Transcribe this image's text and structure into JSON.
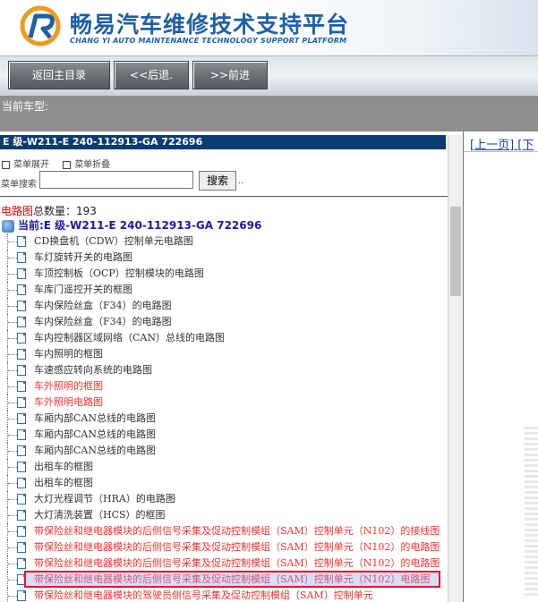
{
  "header": {
    "title": "畅易汽车维修技术支持平台",
    "subtitle": "CHANG YI AUTO MAINTENANCE TECHNOLOGY SUPPORT PLATFORM"
  },
  "nav": {
    "back_main": "返回主目录",
    "back": "<<后退.",
    "forward": ">>前进"
  },
  "current_model_label": "当前车型:",
  "vehicle": "E 级-W211-E 240-112913-GA 722696",
  "menu": {
    "expand": "菜单展开",
    "collapse": "菜单折叠",
    "search_label": "菜单搜索",
    "search_value": "",
    "search_button": "搜索",
    "dots": ".."
  },
  "count": {
    "prefix": "电路图",
    "label": "总数量：",
    "value": "193"
  },
  "root_label": "当前:E 级-W211-E 240-112913-GA 722696",
  "items": [
    {
      "label": "CD换盘机（CDW）控制单元电路图",
      "red": false
    },
    {
      "label": "车灯旋转开关的电路图",
      "red": false
    },
    {
      "label": "车顶控制板（OCP）控制模块的电路图",
      "red": false
    },
    {
      "label": "车库门遥控开关的框图",
      "red": false
    },
    {
      "label": "车内保险丝盒（F34）的电路图",
      "red": false
    },
    {
      "label": "车内保险丝盒（F34）的电路图",
      "red": false
    },
    {
      "label": "车内控制器区域网络（CAN）总线的电路图",
      "red": false
    },
    {
      "label": "车内照明的框图",
      "red": false
    },
    {
      "label": "车速感应转向系统的电路图",
      "red": false
    },
    {
      "label": "车外照明的框图",
      "red": true
    },
    {
      "label": "车外照明电路图",
      "red": true
    },
    {
      "label": "车厢内部CAN总线的电路图",
      "red": false
    },
    {
      "label": "车厢内部CAN总线的电路图",
      "red": false
    },
    {
      "label": "车厢内部CAN总线的电路图",
      "red": false
    },
    {
      "label": "出租车的框图",
      "red": false
    },
    {
      "label": "出租车的框图",
      "red": false
    },
    {
      "label": "大灯光程调节（HRA）的电路图",
      "red": false
    },
    {
      "label": "大灯清洗装置（HCS）的框图",
      "red": false
    },
    {
      "label": "带保险丝和继电器模块的后侧信号采集及促动控制模组（SAM）控制单元（N102）的接线图",
      "red": true
    },
    {
      "label": "带保险丝和继电器模块的后侧信号采集及促动控制模组（SAM）控制单元（N102）的电路图",
      "red": true
    },
    {
      "label": "带保险丝和继电器模块的后侧信号采集及促动控制模组（SAM）控制单元（N102）的电路图",
      "red": true
    },
    {
      "label": "带保险丝和继电器模块的后侧信号采集及促动控制模组（SAM）控制单元（N102）电路图",
      "red": true
    },
    {
      "label": "带保险丝和继电器模块的驾驶员侧信号采集及促动控制模组（SAM）控制单元",
      "red": true
    }
  ],
  "right": {
    "prev_page": "[上一页]",
    "next_fragment": "[下"
  },
  "colors": {
    "brand": "#1f5fa8",
    "vehicle_bar": "#0a3c74",
    "highlight_border": "#e2162a",
    "red_item": "#e33333"
  }
}
